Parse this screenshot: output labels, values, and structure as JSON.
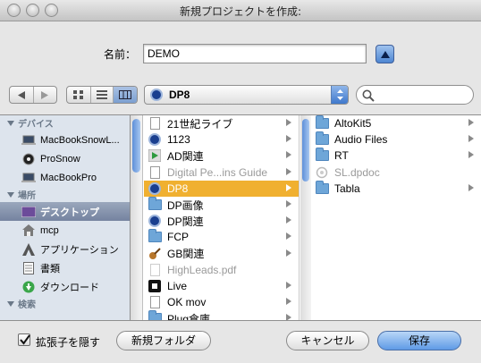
{
  "window": {
    "title": "新規プロジェクトを作成:"
  },
  "name": {
    "label": "名前：",
    "value": "DEMO"
  },
  "path_popup": {
    "label": "DP8"
  },
  "search": {
    "placeholder": ""
  },
  "sidebar": {
    "sections": [
      {
        "header": "デバイス",
        "items": [
          {
            "label": "MacBookSnowL...",
            "icon": "laptop-icon"
          },
          {
            "label": "ProSnow",
            "icon": "disk-icon"
          },
          {
            "label": "MacBookPro",
            "icon": "laptop-icon"
          }
        ]
      },
      {
        "header": "場所",
        "items": [
          {
            "label": "デスクトップ",
            "icon": "desktop-icon",
            "selected": true
          },
          {
            "label": "mcp",
            "icon": "home-icon"
          },
          {
            "label": "アプリケーション",
            "icon": "applications-icon"
          },
          {
            "label": "書類",
            "icon": "documents-icon"
          },
          {
            "label": "ダウンロード",
            "icon": "downloads-icon"
          }
        ]
      },
      {
        "header": "検索",
        "items": []
      }
    ]
  },
  "column1": [
    {
      "label": "21世紀ライブ",
      "icon": "document-icon",
      "arrow": true
    },
    {
      "label": "1123",
      "icon": "dp-app-icon",
      "arrow": true
    },
    {
      "label": "AD関連",
      "icon": "green-arrow-icon",
      "arrow": true
    },
    {
      "label": "Digital Pe...ins Guide",
      "icon": "document-icon",
      "arrow": true,
      "dim": true
    },
    {
      "label": "DP8",
      "icon": "dp-app-icon",
      "arrow": true,
      "selected": true
    },
    {
      "label": "DP画像",
      "icon": "folder-icon",
      "arrow": true
    },
    {
      "label": "DP関連",
      "icon": "dp-app-icon",
      "arrow": true
    },
    {
      "label": "FCP",
      "icon": "folder-icon",
      "arrow": true
    },
    {
      "label": "GB関連",
      "icon": "guitar-icon",
      "arrow": true
    },
    {
      "label": "HighLeads.pdf",
      "icon": "document-icon",
      "arrow": false,
      "dim": true
    },
    {
      "label": "Live",
      "icon": "live-icon",
      "arrow": true
    },
    {
      "label": "OK mov",
      "icon": "document-icon",
      "arrow": true
    },
    {
      "label": "Plug倉庫",
      "icon": "folder-icon",
      "arrow": true
    }
  ],
  "column2": [
    {
      "label": "AltoKit5",
      "icon": "folder-icon",
      "arrow": true
    },
    {
      "label": "Audio Files",
      "icon": "folder-icon",
      "arrow": true
    },
    {
      "label": "RT",
      "icon": "folder-icon",
      "arrow": true
    },
    {
      "label": "SL.dpdoc",
      "icon": "dpdoc-icon",
      "arrow": false,
      "dim": true
    },
    {
      "label": "Tabla",
      "icon": "folder-icon",
      "arrow": true
    }
  ],
  "footer": {
    "hide_extension_label": "拡張子を隠す",
    "hide_extension_checked": true,
    "new_folder_label": "新規フォルダ",
    "cancel_label": "キャンセル",
    "save_label": "保存"
  },
  "colors": {
    "selection": "#f0b030",
    "sidebar_bg": "#dde4ed",
    "sidebar_selection": "#7583a0",
    "default_button": "#5f9ae6"
  }
}
